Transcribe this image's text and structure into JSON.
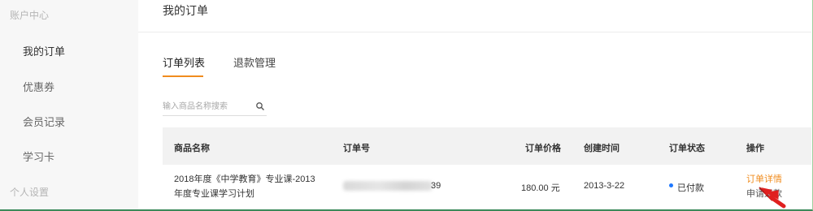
{
  "sidebar": {
    "group_account": "账户中心",
    "items": [
      {
        "label": "我的订单"
      },
      {
        "label": "优惠券"
      },
      {
        "label": "会员记录"
      },
      {
        "label": "学习卡"
      }
    ],
    "group_personal": "个人设置"
  },
  "main": {
    "title": "我的订单",
    "tabs": [
      {
        "label": "订单列表",
        "active": true
      },
      {
        "label": "退款管理",
        "active": false
      }
    ],
    "search": {
      "placeholder": "输入商品名称搜索",
      "value": ""
    },
    "table": {
      "columns": [
        "商品名称",
        "订单号",
        "订单价格",
        "创建时间",
        "订单状态",
        "操作"
      ],
      "rows": [
        {
          "product_line1": "2018年度《中学教育》专业课-2013",
          "product_line2": "年度专业课学习计划",
          "order_no_suffix": "39",
          "price": "180.00 元",
          "created": "2013-3-22",
          "status": "已付款",
          "actions": [
            "订单详情",
            "申请退款"
          ]
        }
      ]
    }
  },
  "colors": {
    "accent": "#f08c1e",
    "status_paid": "#1e78ff",
    "cursor": "#e02020"
  },
  "icons": [
    "search-icon",
    "status-dot-icon",
    "mouse-cursor-icon"
  ]
}
